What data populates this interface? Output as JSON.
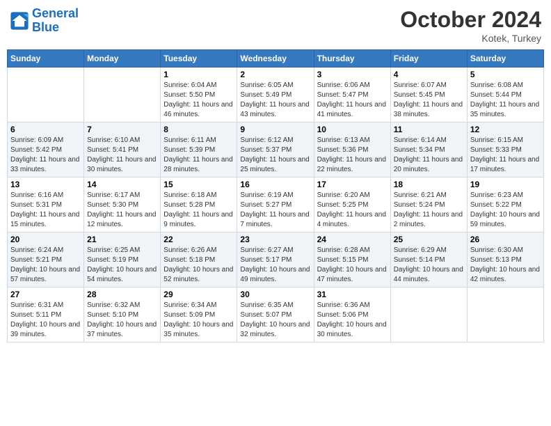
{
  "header": {
    "logo_line1": "General",
    "logo_line2": "Blue",
    "month": "October 2024",
    "location": "Kotek, Turkey"
  },
  "weekdays": [
    "Sunday",
    "Monday",
    "Tuesday",
    "Wednesday",
    "Thursday",
    "Friday",
    "Saturday"
  ],
  "weeks": [
    [
      {
        "day": "",
        "info": ""
      },
      {
        "day": "",
        "info": ""
      },
      {
        "day": "1",
        "info": "Sunrise: 6:04 AM\nSunset: 5:50 PM\nDaylight: 11 hours and 46 minutes."
      },
      {
        "day": "2",
        "info": "Sunrise: 6:05 AM\nSunset: 5:49 PM\nDaylight: 11 hours and 43 minutes."
      },
      {
        "day": "3",
        "info": "Sunrise: 6:06 AM\nSunset: 5:47 PM\nDaylight: 11 hours and 41 minutes."
      },
      {
        "day": "4",
        "info": "Sunrise: 6:07 AM\nSunset: 5:45 PM\nDaylight: 11 hours and 38 minutes."
      },
      {
        "day": "5",
        "info": "Sunrise: 6:08 AM\nSunset: 5:44 PM\nDaylight: 11 hours and 35 minutes."
      }
    ],
    [
      {
        "day": "6",
        "info": "Sunrise: 6:09 AM\nSunset: 5:42 PM\nDaylight: 11 hours and 33 minutes."
      },
      {
        "day": "7",
        "info": "Sunrise: 6:10 AM\nSunset: 5:41 PM\nDaylight: 11 hours and 30 minutes."
      },
      {
        "day": "8",
        "info": "Sunrise: 6:11 AM\nSunset: 5:39 PM\nDaylight: 11 hours and 28 minutes."
      },
      {
        "day": "9",
        "info": "Sunrise: 6:12 AM\nSunset: 5:37 PM\nDaylight: 11 hours and 25 minutes."
      },
      {
        "day": "10",
        "info": "Sunrise: 6:13 AM\nSunset: 5:36 PM\nDaylight: 11 hours and 22 minutes."
      },
      {
        "day": "11",
        "info": "Sunrise: 6:14 AM\nSunset: 5:34 PM\nDaylight: 11 hours and 20 minutes."
      },
      {
        "day": "12",
        "info": "Sunrise: 6:15 AM\nSunset: 5:33 PM\nDaylight: 11 hours and 17 minutes."
      }
    ],
    [
      {
        "day": "13",
        "info": "Sunrise: 6:16 AM\nSunset: 5:31 PM\nDaylight: 11 hours and 15 minutes."
      },
      {
        "day": "14",
        "info": "Sunrise: 6:17 AM\nSunset: 5:30 PM\nDaylight: 11 hours and 12 minutes."
      },
      {
        "day": "15",
        "info": "Sunrise: 6:18 AM\nSunset: 5:28 PM\nDaylight: 11 hours and 9 minutes."
      },
      {
        "day": "16",
        "info": "Sunrise: 6:19 AM\nSunset: 5:27 PM\nDaylight: 11 hours and 7 minutes."
      },
      {
        "day": "17",
        "info": "Sunrise: 6:20 AM\nSunset: 5:25 PM\nDaylight: 11 hours and 4 minutes."
      },
      {
        "day": "18",
        "info": "Sunrise: 6:21 AM\nSunset: 5:24 PM\nDaylight: 11 hours and 2 minutes."
      },
      {
        "day": "19",
        "info": "Sunrise: 6:23 AM\nSunset: 5:22 PM\nDaylight: 10 hours and 59 minutes."
      }
    ],
    [
      {
        "day": "20",
        "info": "Sunrise: 6:24 AM\nSunset: 5:21 PM\nDaylight: 10 hours and 57 minutes."
      },
      {
        "day": "21",
        "info": "Sunrise: 6:25 AM\nSunset: 5:19 PM\nDaylight: 10 hours and 54 minutes."
      },
      {
        "day": "22",
        "info": "Sunrise: 6:26 AM\nSunset: 5:18 PM\nDaylight: 10 hours and 52 minutes."
      },
      {
        "day": "23",
        "info": "Sunrise: 6:27 AM\nSunset: 5:17 PM\nDaylight: 10 hours and 49 minutes."
      },
      {
        "day": "24",
        "info": "Sunrise: 6:28 AM\nSunset: 5:15 PM\nDaylight: 10 hours and 47 minutes."
      },
      {
        "day": "25",
        "info": "Sunrise: 6:29 AM\nSunset: 5:14 PM\nDaylight: 10 hours and 44 minutes."
      },
      {
        "day": "26",
        "info": "Sunrise: 6:30 AM\nSunset: 5:13 PM\nDaylight: 10 hours and 42 minutes."
      }
    ],
    [
      {
        "day": "27",
        "info": "Sunrise: 6:31 AM\nSunset: 5:11 PM\nDaylight: 10 hours and 39 minutes."
      },
      {
        "day": "28",
        "info": "Sunrise: 6:32 AM\nSunset: 5:10 PM\nDaylight: 10 hours and 37 minutes."
      },
      {
        "day": "29",
        "info": "Sunrise: 6:34 AM\nSunset: 5:09 PM\nDaylight: 10 hours and 35 minutes."
      },
      {
        "day": "30",
        "info": "Sunrise: 6:35 AM\nSunset: 5:07 PM\nDaylight: 10 hours and 32 minutes."
      },
      {
        "day": "31",
        "info": "Sunrise: 6:36 AM\nSunset: 5:06 PM\nDaylight: 10 hours and 30 minutes."
      },
      {
        "day": "",
        "info": ""
      },
      {
        "day": "",
        "info": ""
      }
    ]
  ]
}
